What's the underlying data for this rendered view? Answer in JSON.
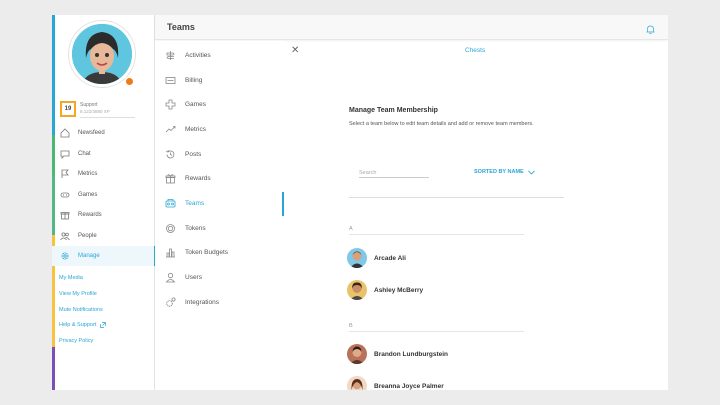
{
  "header": {
    "title": "Teams"
  },
  "profile": {
    "level": "19",
    "name": "Support",
    "xp": "8,122/3880 XP"
  },
  "nav": [
    {
      "label": "Newsfeed",
      "icon": "home-icon"
    },
    {
      "label": "Chat",
      "icon": "chat-icon"
    },
    {
      "label": "Metrics",
      "icon": "flag-icon"
    },
    {
      "label": "Games",
      "icon": "gamepad-icon"
    },
    {
      "label": "Rewards",
      "icon": "gift-icon"
    },
    {
      "label": "People",
      "icon": "people-icon"
    },
    {
      "label": "Manage",
      "icon": "gear-icon",
      "active": true
    }
  ],
  "links": [
    "My Media",
    "View My Profile",
    "Mute Notifications",
    "Help & Support",
    "Privacy Policy"
  ],
  "menu": [
    {
      "label": "Activities",
      "icon": "activities-icon"
    },
    {
      "label": "Billing",
      "icon": "billing-icon"
    },
    {
      "label": "Games",
      "icon": "games-icon"
    },
    {
      "label": "Metrics",
      "icon": "trend-icon"
    },
    {
      "label": "Posts",
      "icon": "history-icon"
    },
    {
      "label": "Rewards",
      "icon": "gift-icon"
    },
    {
      "label": "Teams",
      "icon": "teams-icon",
      "active": true
    },
    {
      "label": "Tokens",
      "icon": "token-icon"
    },
    {
      "label": "Token Budgets",
      "icon": "bar-chart-icon"
    },
    {
      "label": "Users",
      "icon": "user-icon"
    },
    {
      "label": "Integrations",
      "icon": "integrations-icon"
    }
  ],
  "main": {
    "tab": "Chests",
    "title": "Manage Team Membership",
    "subtitle": "Select a team below to edit team details and add or remove team members.",
    "search_placeholder": "Search",
    "sort_label": "SORTED BY NAME",
    "groups": [
      {
        "letter": "A",
        "members": [
          "Arcade Ali",
          "Ashley McBerry"
        ]
      },
      {
        "letter": "B",
        "members": [
          "Brandon Lundburgstein",
          "Breanna Joyce Palmer"
        ]
      }
    ]
  },
  "colors": {
    "accent": "#2aa6d4",
    "level_border": "#f5a623",
    "avatar_bg": "#5fc6e0"
  }
}
